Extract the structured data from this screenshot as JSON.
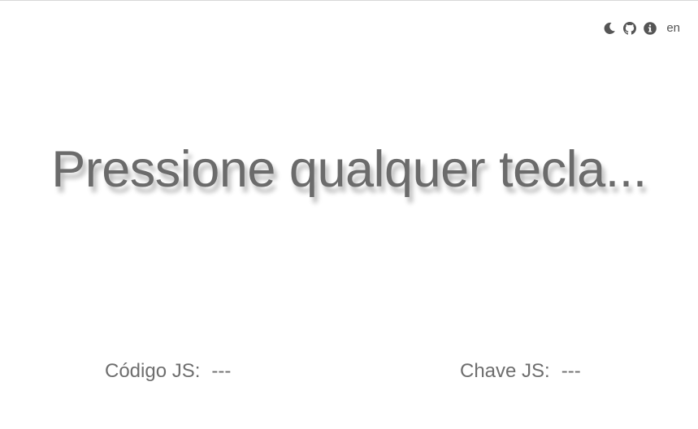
{
  "toolbar": {
    "icons": [
      "moon-icon",
      "github-icon",
      "info-icon"
    ],
    "language": "en"
  },
  "prompt": "Pressione qualquer tecla...",
  "code": {
    "label": "Código JS:",
    "value": "---"
  },
  "key": {
    "label": "Chave JS:",
    "value": "---"
  },
  "colors": {
    "text": "#6b6b6b",
    "icon": "#555555"
  }
}
